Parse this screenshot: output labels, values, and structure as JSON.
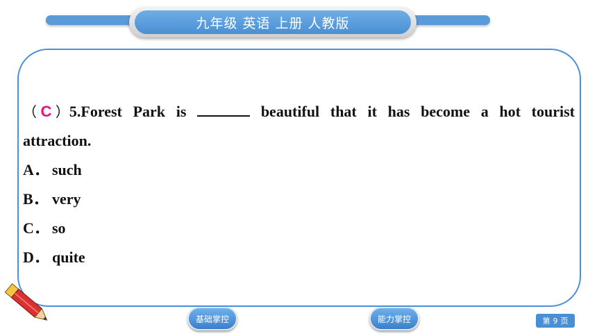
{
  "header": {
    "title": "九年级  英语  上册  人教版"
  },
  "question": {
    "open_paren": "（",
    "answer": "C",
    "close_paren": "）",
    "number": "5.",
    "words_line1": [
      "Forest",
      "Park",
      "is"
    ],
    "words_line1_after": [
      "beautiful",
      "that",
      "it",
      "has",
      "become",
      "a",
      "hot",
      "tourist"
    ],
    "line2": "attraction."
  },
  "options": [
    {
      "letter": "A．",
      "text": "such"
    },
    {
      "letter": "B．",
      "text": "very"
    },
    {
      "letter": "C．",
      "text": "so"
    },
    {
      "letter": "D．",
      "text": "quite"
    }
  ],
  "nav": {
    "basic_label": "基础掌控",
    "ability_label": "能力掌控"
  },
  "page": {
    "prefix": "第",
    "number": "9",
    "suffix": "页"
  },
  "colors": {
    "accent": "#4a90d9",
    "answer": "#e0147a"
  },
  "icons": {
    "decoration": "pencil-icon"
  }
}
